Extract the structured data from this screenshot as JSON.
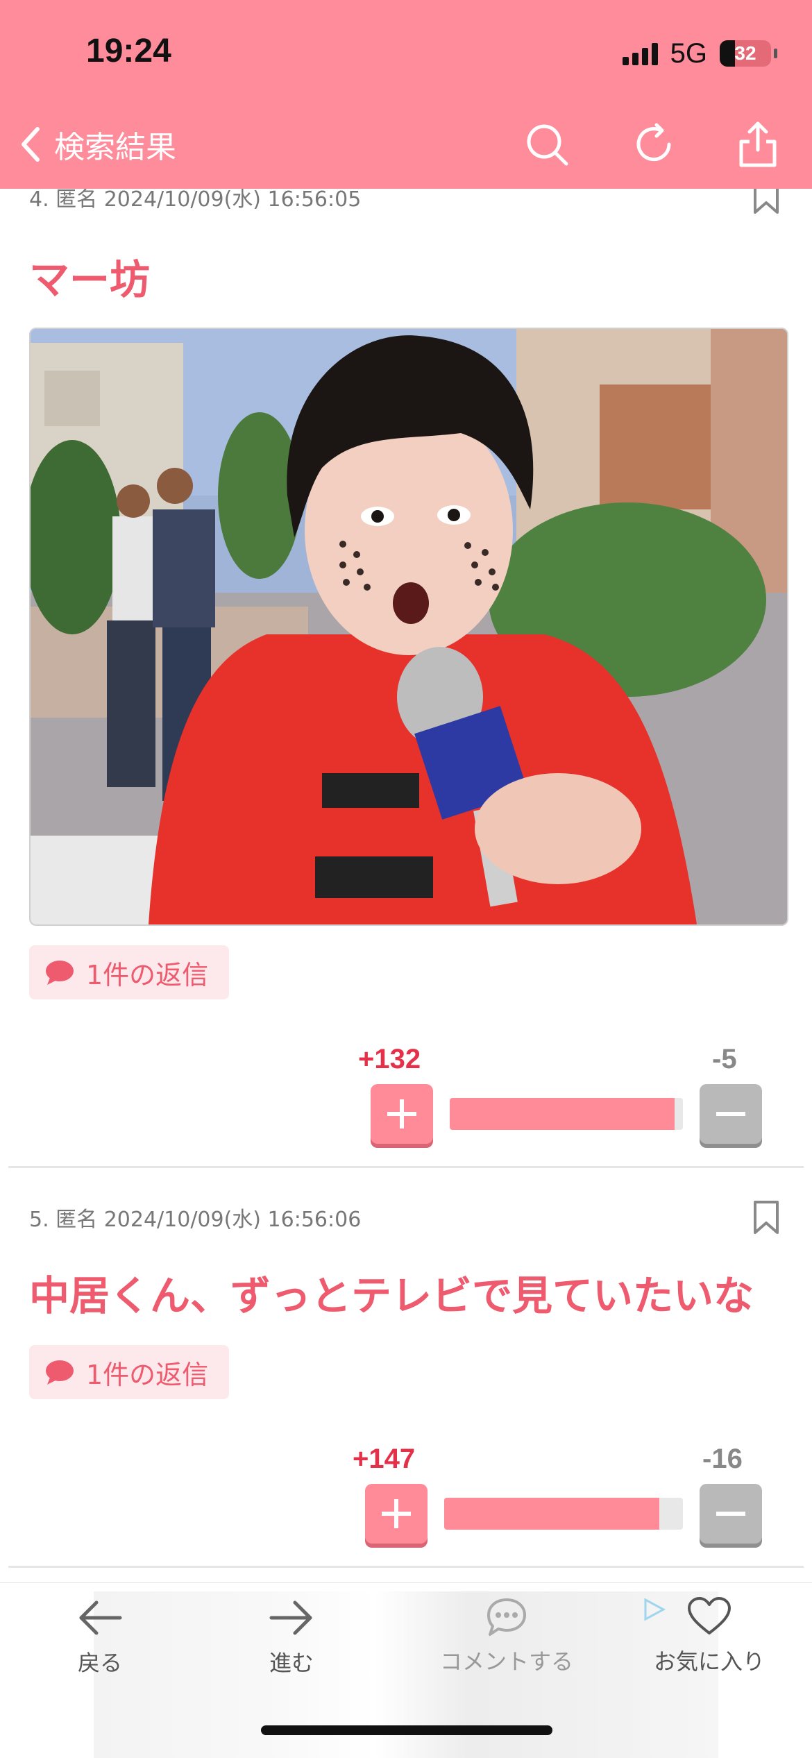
{
  "status": {
    "time": "19:24",
    "network": "5G",
    "battery": "32"
  },
  "nav": {
    "back_label": "検索結果",
    "icons": [
      "search-icon",
      "refresh-icon",
      "share-icon"
    ]
  },
  "posts": [
    {
      "meta": "4. 匿名 2024/10/09(水) 16:56:05",
      "title": "マー坊",
      "reply": "1件の返信",
      "plus": "+132",
      "minus": "-5",
      "ratio": 0.964
    },
    {
      "meta": "5. 匿名 2024/10/09(水) 16:56:06",
      "title": "中居くん、ずっとテレビで見ていたいな",
      "reply": "1件の返信",
      "plus": "+147",
      "minus": "-16",
      "ratio": 0.902
    }
  ],
  "tabs": [
    {
      "label": "戻る",
      "icon": "arrow-left-icon"
    },
    {
      "label": "進む",
      "icon": "arrow-right-icon"
    },
    {
      "label": "コメントする",
      "icon": "comment-icon"
    },
    {
      "label": "お気に入り",
      "icon": "heart-icon"
    }
  ],
  "colors": {
    "accent": "#ff8c9a",
    "title": "#ee5a6e",
    "plus": "#e43049",
    "minus": "#888888"
  }
}
